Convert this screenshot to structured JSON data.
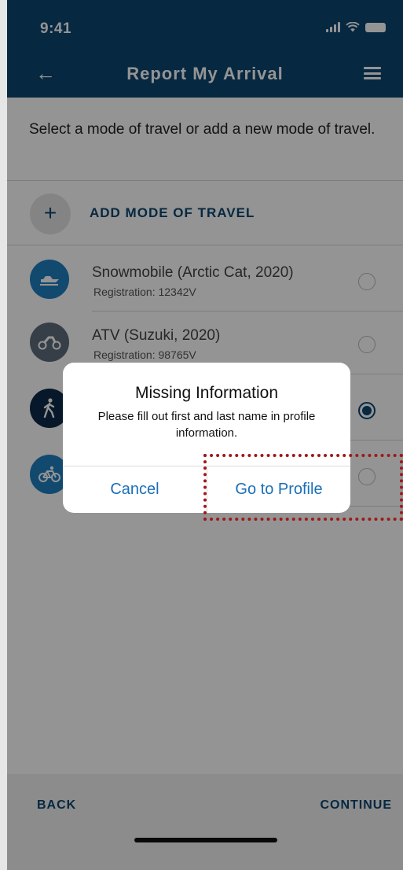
{
  "status_bar": {
    "time": "9:41"
  },
  "nav": {
    "back_icon": "←",
    "title": "Report My Arrival",
    "menu_icon": "hamburger-menu-icon"
  },
  "instruction": "Select a mode of travel or add a new mode of travel.",
  "add_mode": {
    "icon": "+",
    "label": "ADD MODE OF TRAVEL"
  },
  "travel_modes": [
    {
      "name": "Snowmobile (Arctic Cat, 2020)",
      "registration": "Registration: 12342V",
      "icon": "snowmobile-icon",
      "color": "#1f7fc0",
      "selected": false
    },
    {
      "name": "ATV (Suzuki, 2020)",
      "registration": "Registration: 98765V",
      "icon": "atv-icon",
      "color": "#5e6b7c",
      "selected": false
    },
    {
      "name": "",
      "registration": "",
      "icon": "walking-icon",
      "color": "#0c2a47",
      "selected": true
    },
    {
      "name": "",
      "registration": "",
      "icon": "bicycle-icon",
      "color": "#1f7fc0",
      "selected": false
    }
  ],
  "dialog": {
    "title": "Missing Information",
    "message": "Please fill out first and last name in  profile information.",
    "cancel_label": "Cancel",
    "confirm_label": "Go to Profile"
  },
  "footer": {
    "back_label": "BACK",
    "continue_label": "CONTINUE"
  },
  "colors": {
    "brand": "#0b4570",
    "link": "#1a6fb8",
    "highlight": "#a01818"
  }
}
